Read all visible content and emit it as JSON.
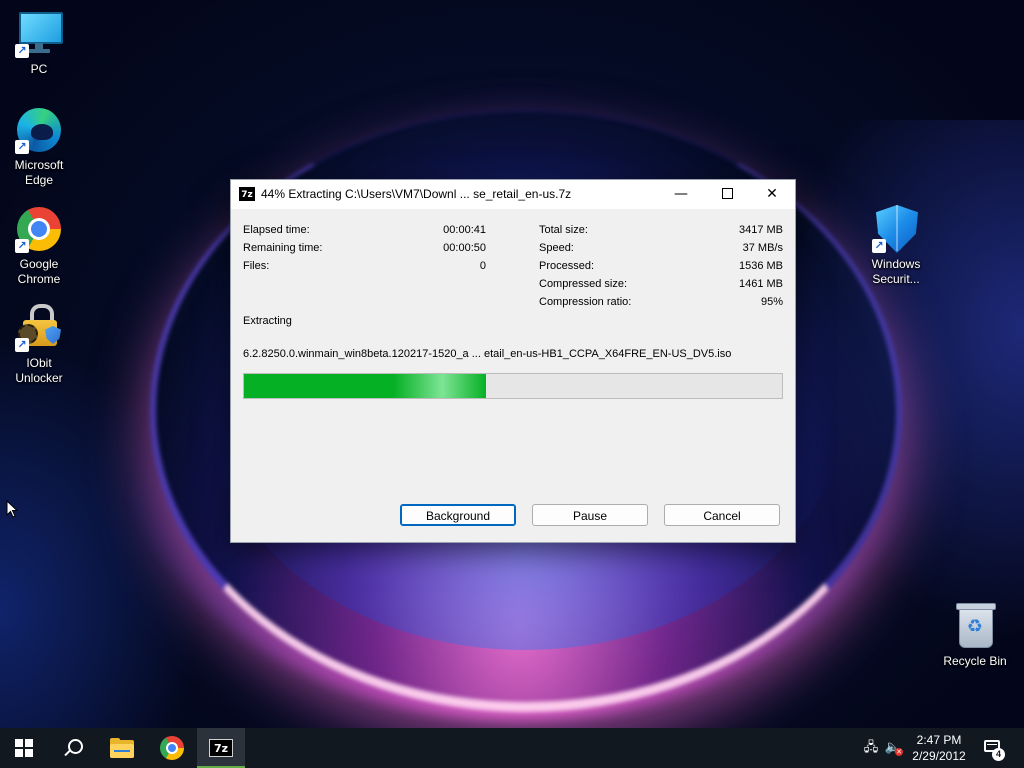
{
  "desktop": {
    "icons": [
      {
        "label": "PC",
        "icon": "pc-icon"
      },
      {
        "label": "Microsoft Edge",
        "icon": "edge-icon"
      },
      {
        "label": "Google Chrome",
        "icon": "chrome-icon"
      },
      {
        "label": "IObit Unlocker",
        "icon": "iobit-unlocker-icon"
      },
      {
        "label": "Windows Securit...",
        "icon": "windows-security-icon"
      },
      {
        "label": "Recycle Bin",
        "icon": "recycle-bin-icon"
      }
    ]
  },
  "window": {
    "title": "44% Extracting C:\\Users\\VM7\\Downl ... se_retail_en-us.7z",
    "app_icon_text": "7z",
    "controls": {
      "minimize": "—",
      "close": "✕"
    },
    "left_stats": [
      {
        "label": "Elapsed time:",
        "value": "00:00:41"
      },
      {
        "label": "Remaining time:",
        "value": "00:00:50"
      },
      {
        "label": "Files:",
        "value": "0"
      }
    ],
    "right_stats": [
      {
        "label": "Total size:",
        "value": "3417 MB"
      },
      {
        "label": "Speed:",
        "value": "37 MB/s"
      },
      {
        "label": "Processed:",
        "value": "1536 MB"
      },
      {
        "label": "Compressed size:",
        "value": "1461 MB"
      },
      {
        "label": "Compression ratio:",
        "value": "95%"
      }
    ],
    "section_label": "Extracting",
    "current_file": "6.2.8250.0.winmain_win8beta.120217-1520_a ... etail_en-us-HB1_CCPA_X64FRE_EN-US_DV5.iso",
    "progress_percent": 45,
    "buttons": {
      "background": "Background",
      "pause": "Pause",
      "cancel": "Cancel"
    },
    "colors": {
      "progress": "#06b025",
      "default_button_border": "#0067c0"
    }
  },
  "taskbar": {
    "items": [
      "start-icon",
      "search-icon",
      "file-explorer-icon",
      "chrome-icon",
      "7zip-icon"
    ],
    "active_item": "7zip-icon",
    "tray": {
      "network_icon": "network-icon",
      "volume_icon": "volume-muted-icon",
      "time": "2:47 PM",
      "date": "2/29/2012",
      "notification_count": "4"
    }
  }
}
